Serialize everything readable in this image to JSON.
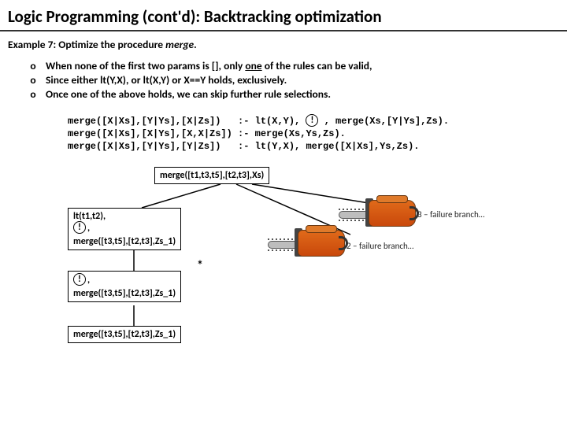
{
  "title": "Logic Programming (cont'd):   Backtracking optimization",
  "example_label": "Example 7:",
  "example_text_pre": "  Optimize the procedure ",
  "example_proc": "merge",
  "example_text_post": ".",
  "bullets": [
    {
      "pre": "When none of the first two params is [], only ",
      "u": "one",
      "post": " of the rules can be valid,"
    },
    {
      "pre": "Since either lt(Y,X), or lt(X,Y) or X==Y holds,  exclusively.",
      "u": "",
      "post": ""
    },
    {
      "pre": "Once one of the above holds, we can skip further rule selections.",
      "u": "",
      "post": ""
    }
  ],
  "code": {
    "l1a": "merge([X|Xs],[Y|Ys],[X|Zs])   :- lt(X,Y),",
    "l1b": ", merge(Xs,[Y|Ys],Zs).",
    "l2": "merge([X|Xs],[X|Ys],[X,X|Zs]) :- merge(Xs,Ys,Zs).",
    "l3": "merge([X|Xs],[Y|Ys],[Y|Zs])   :- lt(Y,X), merge([X|Xs],Ys,Zs).",
    "cut": "!"
  },
  "tree": {
    "root": "merge([t1,t3,t5],[t2,t3],Xs)",
    "n1_line1": "lt(t1,t2),",
    "n1_cut": "!,",
    "n1_line2": "merge([t3,t5],[t2,t3],Zs_1)",
    "n2_cut": "!,",
    "n2_line": "merge([t3,t5],[t2,t3],Zs_1)",
    "n3": "merge([t3,t5],[t2,t3],Zs_1)",
    "star": "*",
    "fail2": "2 – failure branch…",
    "fail3": "3 – failure branch…"
  }
}
